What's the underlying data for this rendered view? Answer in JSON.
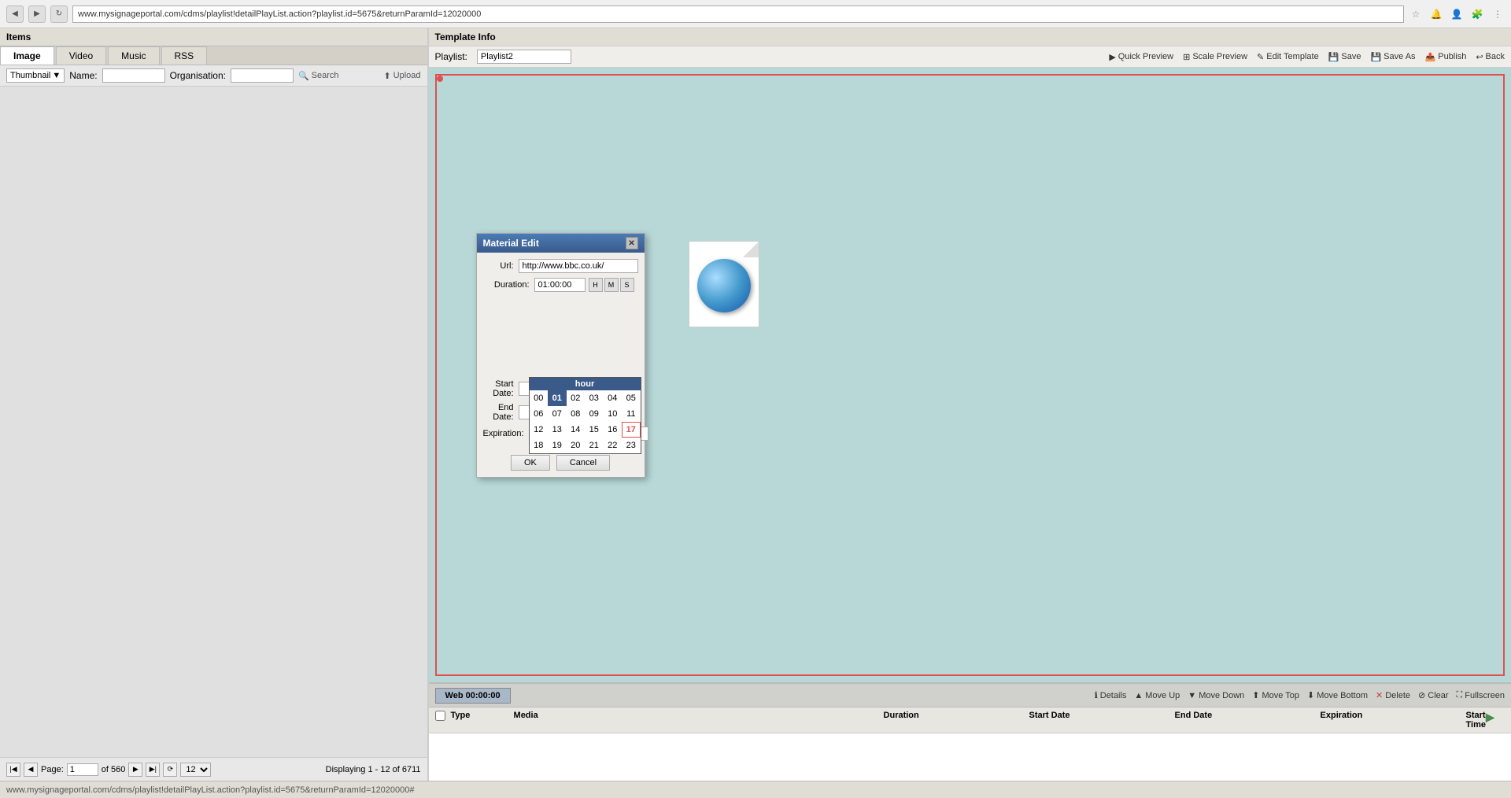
{
  "browser": {
    "url": "www.mysignageportal.com/cdms/playlist!detailPlayList.action?playlist.id=5675&returnParamId=12020000",
    "status_url": "www.mysignageportal.com/cdms/playlist!detailPlayList.action?playlist.id=5675&returnParamId=12020000#"
  },
  "left_panel": {
    "header": "Items",
    "tabs": [
      "Image",
      "Video",
      "Music",
      "RSS"
    ],
    "active_tab": "Image",
    "search": {
      "thumbnail_label": "Thumbnail",
      "name_label": "Name:",
      "org_label": "Organisation:",
      "search_btn": "Search",
      "upload_btn": "Upload"
    }
  },
  "pagination": {
    "page_label": "Page:",
    "current_page": "1",
    "total_pages": "560",
    "per_page": "12",
    "displaying": "Displaying 1 - 12 of 6711"
  },
  "right_panel": {
    "header": "Template Info",
    "playlist_label": "Playlist:",
    "playlist_name": "Playlist2",
    "toolbar_btns": [
      "Quick Preview",
      "Scale Preview",
      "Edit Template",
      "Save",
      "Save As",
      "Publish",
      "Back"
    ]
  },
  "modal": {
    "title": "Material Edit",
    "url_label": "Url:",
    "url_value": "http://www.bbc.co.uk/",
    "duration_label": "Duration:",
    "duration_value": "01:00:00",
    "start_date_label": "Start Date:",
    "end_date_label": "End Date:",
    "expiration_label": "Expiration:",
    "ok_btn": "OK",
    "cancel_btn": "Cancel"
  },
  "hour_picker": {
    "header": "hour",
    "hours": [
      "00",
      "01",
      "02",
      "03",
      "04",
      "05",
      "06",
      "07",
      "08",
      "09",
      "10",
      "11",
      "12",
      "13",
      "14",
      "15",
      "16",
      "17",
      "18",
      "19",
      "20",
      "21",
      "22",
      "23"
    ],
    "selected": "01",
    "highlighted": "17"
  },
  "playlist_bottom": {
    "tab_label": "Web 00:00:00",
    "actions": [
      "Details",
      "Move Up",
      "Move Down",
      "Move Top",
      "Move Bottom",
      "Delete",
      "Clear",
      "Fullscreen"
    ]
  },
  "table": {
    "columns": [
      "",
      "Type",
      "Media",
      "Duration",
      "Start Date",
      "End Date",
      "Expiration",
      "Start Time",
      ""
    ]
  }
}
